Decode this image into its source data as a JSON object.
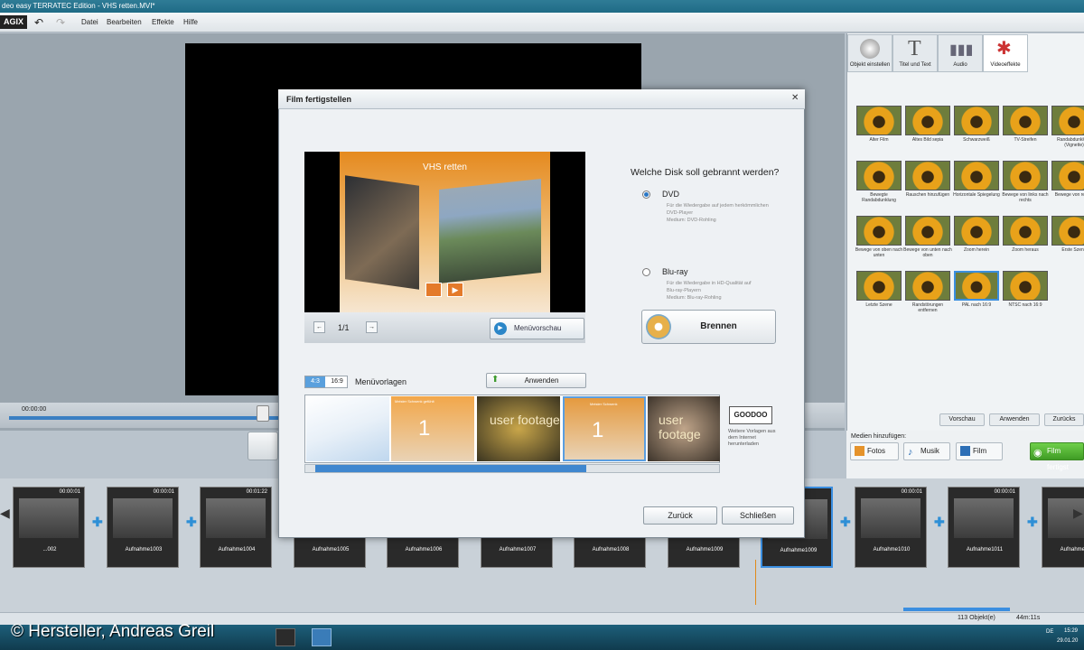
{
  "window": {
    "title": "deo easy TERRATEC Edition - VHS retten.MVI*"
  },
  "menu": {
    "logo": "AGIX",
    "items": [
      "Datei",
      "Bearbeiten",
      "Effekte",
      "Hilfe"
    ]
  },
  "player": {
    "timecode": "00:00:00"
  },
  "right_panel": {
    "tabs": [
      "Objekt einstellen",
      "Titel und Text",
      "Audio",
      "Videoeffekte"
    ],
    "effects": [
      [
        "Alter Film",
        "Altes Bild sepia",
        "Schwarzweiß",
        "TV-Streifen",
        "Randabdunklung (Vignette)"
      ],
      [
        "Bewegte Randabdunklung",
        "Rauschen hinzufügen",
        "Horizontale Spiegelung",
        "Bewege von links nach rechts",
        "Bewege von rechts"
      ],
      [
        "Bewege von oben nach unten",
        "Bewege von unten nach oben",
        "Zoom herein",
        "Zoom heraus",
        "Erste Szene"
      ],
      [
        "Letzte Szene",
        "Randstörungen entfernen",
        "PAL nach 16:9",
        "NTSC nach 16:9"
      ]
    ],
    "buttons": [
      "Vorschau",
      "Anwenden",
      "Zurücks"
    ],
    "add_media_label": "Medien hinzufügen:",
    "media_buttons": [
      "Fotos",
      "Musik",
      "Film"
    ],
    "finish_button": "Film fertigst"
  },
  "dialog": {
    "title": "Film fertigstellen",
    "preview_title": "VHS retten",
    "page_indicator": "1/1",
    "menu_preview_button": "Menüvorschau",
    "question": "Welche Disk soll gebrannt werden?",
    "options": [
      {
        "label": "DVD",
        "selected": true,
        "desc": [
          "Für die Wiedergabe auf jedem herkömmlichen",
          "DVD-Player",
          "Medium: DVD-Rohling"
        ]
      },
      {
        "label": "Blu-ray",
        "selected": false,
        "desc": [
          "Für die Wiedergabe in HD-Qualität auf",
          "Blu-ray-Playern",
          "Medium: Blu-ray-Rohling"
        ]
      }
    ],
    "burn_button": "Brennen",
    "ratio_4_3": "4:3",
    "ratio_16_9": "16:9",
    "templates_label": "Menüvorlagen",
    "apply_button": "Anwenden",
    "template_texts": [
      "",
      "Meister Schwenk gefühlt",
      "user footage",
      "Meister Schwenk",
      "user footage"
    ],
    "goodoo_logo": "GOODOO",
    "more_templates_text": "Weitere Vorlagen aus dem Internet herunterladen",
    "back_button": "Zurück",
    "close_button": "Schließen"
  },
  "timeline": {
    "clips": [
      {
        "name": "...002",
        "time": "00:00:01"
      },
      {
        "name": "Aufnahme1003",
        "time": "00:00:01"
      },
      {
        "name": "Aufnahme1004",
        "time": "00:01:22"
      },
      {
        "name": "Aufnahme1005",
        "time": ""
      },
      {
        "name": "Aufnahme1006",
        "time": ""
      },
      {
        "name": "Aufnahme1007",
        "time": ""
      },
      {
        "name": "Aufnahme1008",
        "time": ""
      },
      {
        "name": "Aufnahme1009",
        "time": ""
      },
      {
        "name": "Aufnahme1009",
        "time": ""
      },
      {
        "name": "Aufnahme1010",
        "time": "00:00:01"
      },
      {
        "name": "Aufnahme1011",
        "time": "00:00:01"
      },
      {
        "name": "Aufnahme1012",
        "time": "00:00:01"
      }
    ],
    "status_objects": "113 Objekt(e)",
    "status_duration": "44m:11s"
  },
  "taskbar": {
    "lang": "DE",
    "clock_time": "15:29",
    "clock_date": "29.01.20"
  },
  "watermark": "© Hersteller, Andreas Greil"
}
